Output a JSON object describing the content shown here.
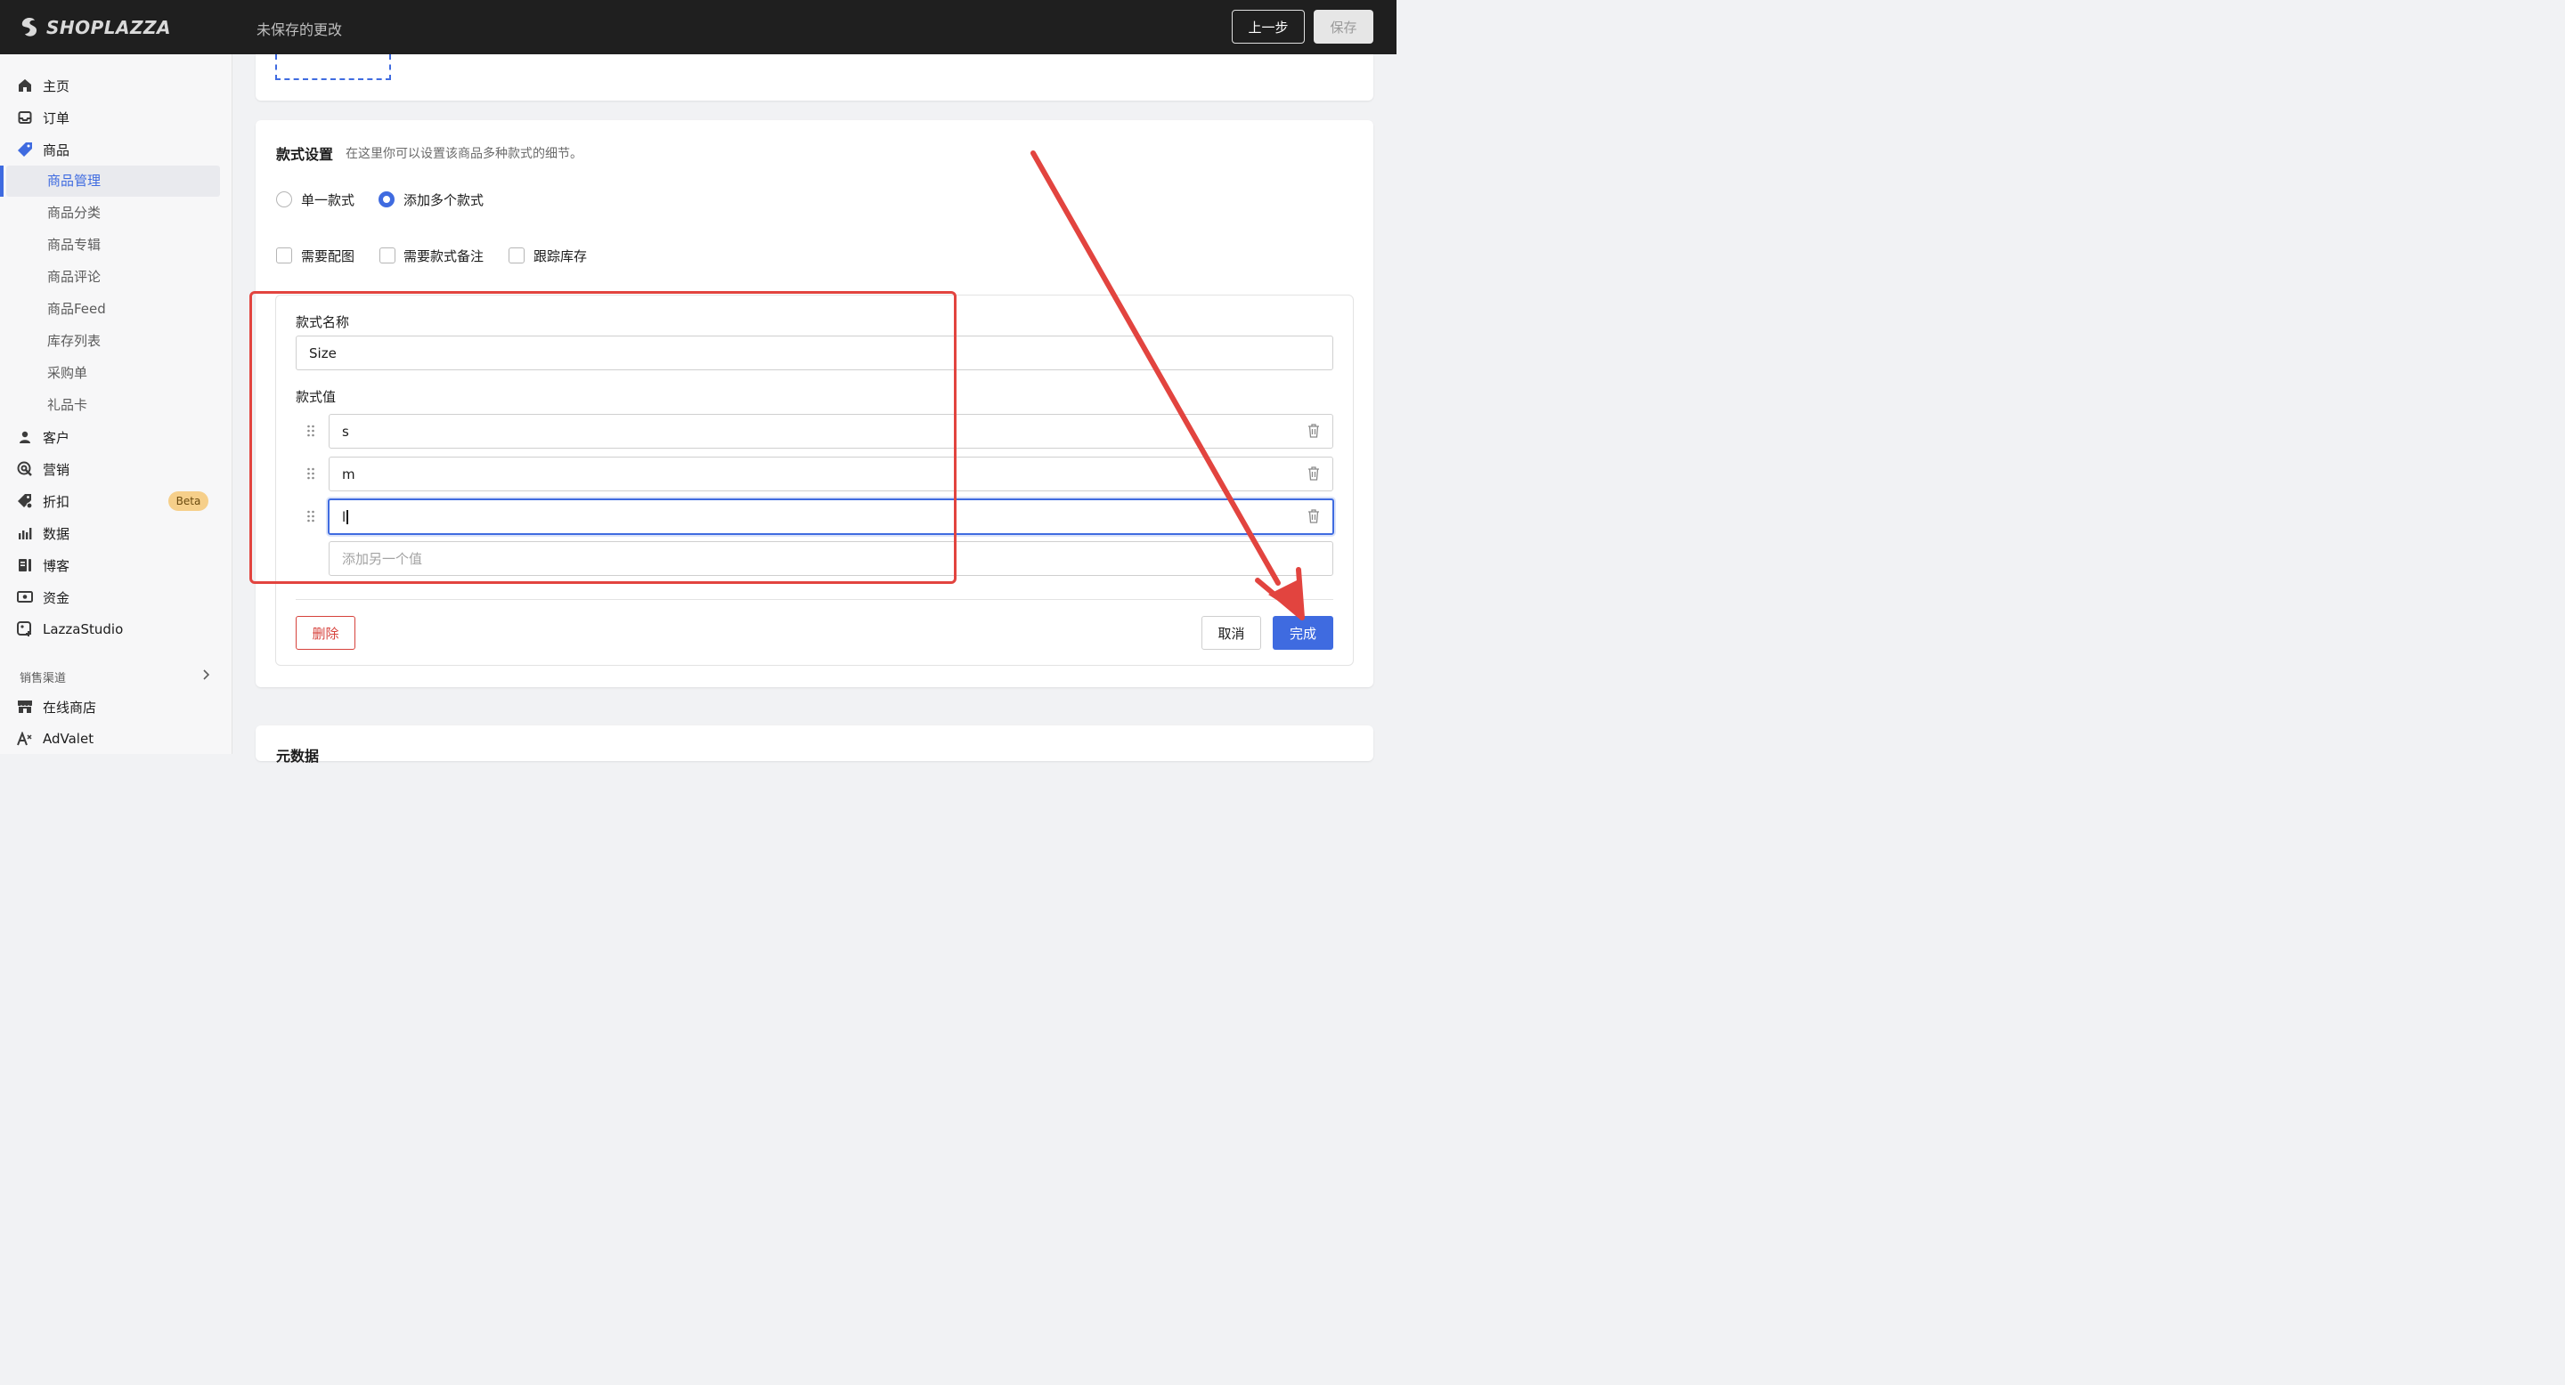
{
  "header": {
    "brand": "SHOPLAZZA",
    "status": "未保存的更改",
    "prev_label": "上一步",
    "save_label": "保存"
  },
  "sidebar": {
    "items": [
      {
        "label": "主页",
        "icon": "home-icon"
      },
      {
        "label": "订单",
        "icon": "inbox-icon"
      },
      {
        "label": "商品",
        "icon": "tag-icon"
      }
    ],
    "product_sub": [
      "商品管理",
      "商品分类",
      "商品专辑",
      "商品评论",
      "商品Feed",
      "库存列表",
      "采购单",
      "礼品卡"
    ],
    "items2": [
      {
        "label": "客户",
        "icon": "person-icon"
      },
      {
        "label": "营销",
        "icon": "target-icon"
      },
      {
        "label": "折扣",
        "icon": "discount-icon"
      },
      {
        "label": "数据",
        "icon": "chart-icon"
      },
      {
        "label": "博客",
        "icon": "blog-icon"
      },
      {
        "label": "资金",
        "icon": "money-icon"
      },
      {
        "label": "LazzaStudio",
        "icon": "studio-icon"
      }
    ],
    "beta": "Beta",
    "channels_title": "销售渠道",
    "channels": [
      {
        "label": "在线商店",
        "icon": "store-icon"
      },
      {
        "label": "AdValet",
        "icon": "advalet-icon"
      }
    ]
  },
  "variant": {
    "title": "款式设置",
    "subtitle": "在这里你可以设置该商品多种款式的细节。",
    "radio_single": "单一款式",
    "radio_multi": "添加多个款式",
    "check_image": "需要配图",
    "check_note": "需要款式备注",
    "check_stock": "跟踪库存",
    "name_label": "款式名称",
    "name_value": "Size",
    "values_label": "款式值",
    "values": [
      "s",
      "m",
      "l"
    ],
    "add_placeholder": "添加另一个值",
    "delete_label": "删除",
    "cancel_label": "取消",
    "done_label": "完成"
  },
  "bottom": {
    "title": "元数据"
  },
  "colors": {
    "accent": "#3f6be0",
    "annotation": "#e2443f",
    "topbar": "#1f1f1f"
  }
}
